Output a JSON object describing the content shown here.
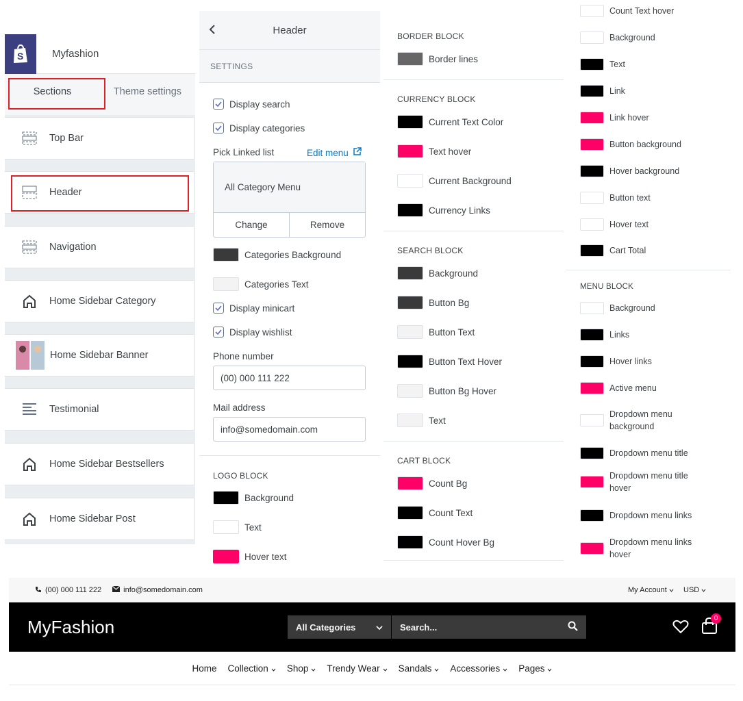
{
  "sidebar": {
    "store_name": "Myfashion",
    "tabs": [
      "Sections",
      "Theme settings"
    ],
    "sections": [
      "Top Bar",
      "Header",
      "Navigation",
      "Home Sidebar Category",
      "Home Sidebar Banner",
      "Testimonial",
      "Home Sidebar Bestsellers",
      "Home Sidebar Post"
    ]
  },
  "header_panel": {
    "title": "Header",
    "settings_label": "SETTINGS",
    "display_search": "Display search",
    "display_categories": "Display categories",
    "pick_linked_list": "Pick Linked list",
    "edit_menu": "Edit menu",
    "linked_list_value": "All Category Menu",
    "change_btn": "Change",
    "remove_btn": "Remove",
    "categories_background": "Categories Background",
    "categories_text": "Categories Text",
    "display_minicart": "Display minicart",
    "display_wishlist": "Display wishlist",
    "phone_label": "Phone number",
    "phone_value": "(00) 000 111 222",
    "mail_label": "Mail address",
    "mail_value": "info@somedomain.com",
    "logo_block": {
      "label": "LOGO BLOCK",
      "items": [
        "Background",
        "Text",
        "Hover text"
      ]
    }
  },
  "col3": {
    "border_block": {
      "label": "BORDER BLOCK",
      "items": [
        "Border lines"
      ]
    },
    "currency_block": {
      "label": "CURRENCY BLOCK",
      "items": [
        "Current Text Color",
        "Text hover",
        "Current Background",
        "Currency Links"
      ]
    },
    "search_block": {
      "label": "SEARCH BLOCK",
      "items": [
        "Background",
        "Button Bg",
        "Button Text",
        "Button Text Hover",
        "Button Bg Hover",
        "Text"
      ]
    },
    "cart_block": {
      "label": "CART BLOCK",
      "items": [
        "Count Bg",
        "Count Text",
        "Count Hover Bg"
      ]
    }
  },
  "col4": {
    "items": [
      "Count Text hover",
      "Background",
      "Text",
      "Link",
      "Link hover",
      "Button background",
      "Hover background",
      "Button text",
      "Hover text",
      "Cart Total"
    ],
    "menu_block": {
      "label": "MENU BLOCK",
      "items": [
        "Background",
        "Links",
        "Hover links",
        "Active menu",
        "Dropdown menu background",
        "Dropdown menu title",
        "Dropdown menu title hover",
        "Dropdown menu links",
        "Dropdown menu links hover"
      ]
    }
  },
  "colors": {
    "black": "#000000",
    "pink": "#ff0066",
    "dark": "#3a3a3a",
    "gray": "#666666",
    "white": "#ffffff",
    "light": "#f3f3f3",
    "accent": "#007ace"
  },
  "preview": {
    "phone": "(00) 000 111 222",
    "email": "info@somedomain.com",
    "my_account": "My Account",
    "currency": "USD",
    "brand": "MyFashion",
    "category_select": "All Categories",
    "search_placeholder": "Search...",
    "cart_count": "0",
    "nav": [
      "Home",
      "Collection",
      "Shop",
      "Trendy Wear",
      "Sandals",
      "Accessories",
      "Pages"
    ]
  }
}
